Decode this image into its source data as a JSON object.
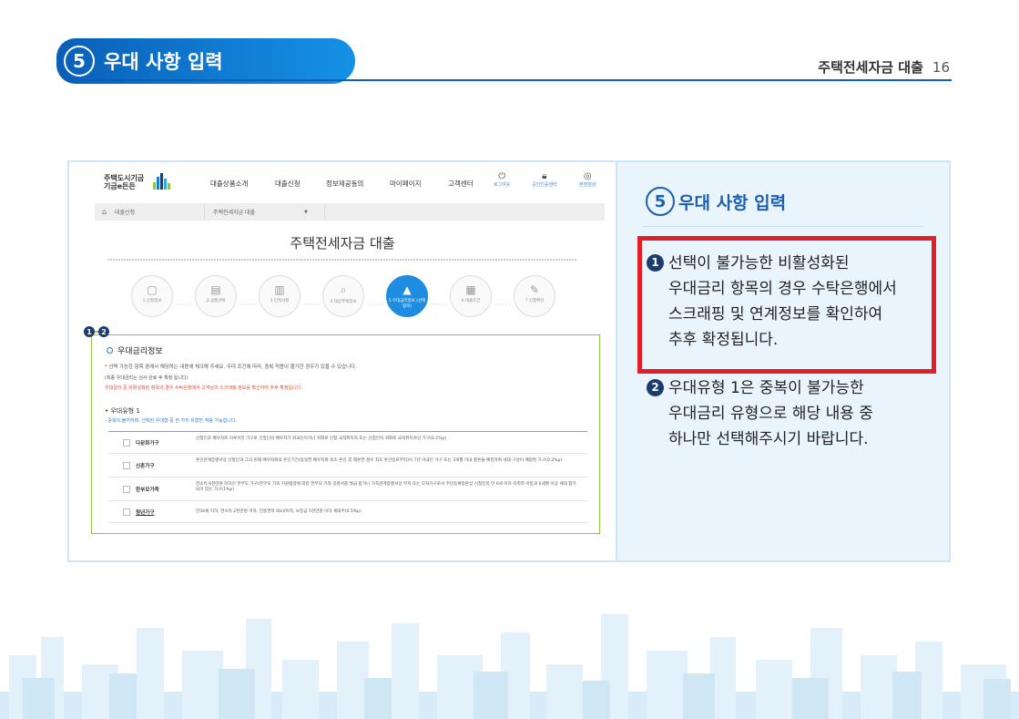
{
  "header": {
    "section_number": "5",
    "section_title": "우대 사항 입력",
    "doc_title": "주택전세자금 대출",
    "page_number": "16"
  },
  "screenshot": {
    "logo_line1": "주택도시기금",
    "logo_line2": "기금e든든",
    "nav": [
      "대출상품소개",
      "대출신청",
      "정보제공동의",
      "마이페이지",
      "고객센터"
    ],
    "utils": [
      "로그아웃",
      "공인인증센터",
      "본점점검"
    ],
    "breadcrumb": {
      "home": "대출신청",
      "current": "주택전세자금 대출"
    },
    "title": "주택전세자금 대출",
    "steps": [
      {
        "icon": "▢",
        "label": "1.신청정보"
      },
      {
        "icon": "▤",
        "label": "2.상품선택"
      },
      {
        "icon": "▥",
        "label": "3.인적사항"
      },
      {
        "icon": "⌕",
        "label": "4.대상주택정보"
      },
      {
        "icon": "▲",
        "label": "5.우대금리정보 (선택항목)"
      },
      {
        "icon": "▦",
        "label": "6.대출조건"
      },
      {
        "icon": "✎",
        "label": "7.신청확인"
      }
    ],
    "badges": [
      "1",
      "2"
    ],
    "section_title": "우대금리정보",
    "line1": "* 선택 가능한 항목 중에서 해당하는 내용에 체크해 주세요. 우대 조건에 따라, 중복 적용이 불가한 경우가 있을 수 있습니다.",
    "line2": "(최종 우대금리는 심사 완료 후 확정 됩니다)",
    "line3": "우대금리 중 비활성화된 항목의 경우 수탁은행에서 고객님의 스크래핑 정보를 확인하여 추후 확정됩니다.",
    "subhead": "• 우대유형 1",
    "line4": "- 중복이 불가하며, 선택된 우대형 중 한 가지 유형만 적용 가능합니다.",
    "rows": [
      {
        "label": "다문화가구",
        "desc": "신청인과 배우자로 이루어진 가구로 신청인의 배우자가 외국인이거나 귀화로 인함 국적취득자 또는 신청인이 귀화로 국적취득자인 가구(0.2%p)"
      },
      {
        "label": "신혼가구",
        "desc": "혼인관계증명서상 신청인과 그의 원재 배우자와의 혼인기간(동일한 배우자와 최초 혼인 후 재혼한 경우 최초 혼인일로부터)이 7년 이내인 가구 또는 3개월 이내 결혼을 예정하여 세대 구성이 예정된 가구(0.2%p)"
      },
      {
        "label": "한부모가족",
        "desc": "연소득 6천만원 이하인 한부모 가구(한부모 가족 지원법령에 따라 한부모 가족 증명서를 발급 받거나 가족관계증명서상 부자 또는 모자가구로서 주민등록등본상 신청인의 만 6세 이하 미취학 아동과 6개월 이상 세대 합가되어 있는 가구(1%p)"
      },
      {
        "label": "청년가구",
        "desc": "만34세 이하, 연소득 2천만원 이하, 전용면적 60㎡이하, 보증금 5천만원 이하 세대주(0.5%p)"
      }
    ]
  },
  "panel": {
    "number": "5",
    "title": "우대 사항 입력",
    "note1_badge": "1",
    "note1_lines": [
      "선택이 불가능한 비활성화된",
      "우대금리 항목의 경우 수탁은행에서",
      "스크래핑 및 연계정보를 확인하여",
      "추후 확정됩니다."
    ],
    "note2_badge": "2",
    "note2_lines": [
      "우대유형 1은 중복이 불가능한",
      "우대금리 유형으로 해당 내용 중",
      "하나만 선택해주시기 바랍니다."
    ]
  },
  "colors": {
    "brand_blue": "#0a5fb8",
    "highlight_red": "#e11f26",
    "green_border": "#8dc63f",
    "panel_bg": "#e9f4fc"
  }
}
